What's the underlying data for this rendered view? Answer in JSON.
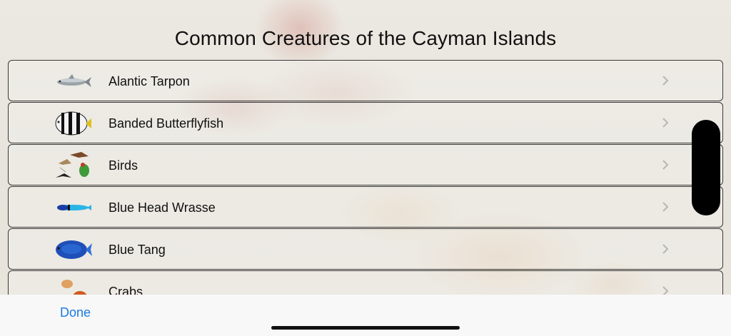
{
  "title": "Common Creatures of the Cayman Islands",
  "items": [
    {
      "label": "Alantic Tarpon",
      "icon": "tarpon-fish-icon"
    },
    {
      "label": "Banded Butterflyfish",
      "icon": "butterflyfish-icon"
    },
    {
      "label": "Birds",
      "icon": "birds-icon"
    },
    {
      "label": "Blue Head Wrasse",
      "icon": "wrasse-fish-icon"
    },
    {
      "label": "Blue Tang",
      "icon": "blue-tang-icon"
    },
    {
      "label": "Crabs",
      "icon": "crabs-icon"
    }
  ],
  "toolbar": {
    "done_label": "Done"
  },
  "colors": {
    "accent": "#1a7ae0",
    "row_border": "#3a3a3a"
  }
}
